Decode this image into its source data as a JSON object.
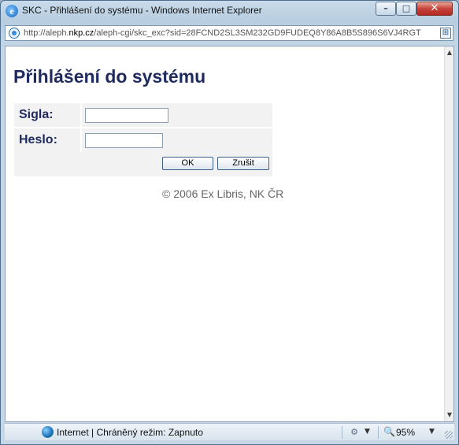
{
  "window": {
    "title": "SKC - Přihlášení do systému - Windows Internet Explorer",
    "minimize_icon": "minimize-icon",
    "maximize_icon": "maximize-icon",
    "close_icon": "close-icon"
  },
  "address": {
    "prefix": "http://aleph.",
    "domain": "nkp.cz",
    "rest": "/aleph-cgi/skc_exc?sid=28FCND2SL3SM232GD9FUDEQ8Y86A8B5S896S6VJ4RGT"
  },
  "page": {
    "heading": "Přihlášení do systému",
    "form": {
      "sigla_label": "Sigla:",
      "sigla_value": "",
      "heslo_label": "Heslo:",
      "heslo_value": "",
      "ok_label": "OK",
      "cancel_label": "Zrušit"
    },
    "footer": "© 2006 Ex Libris, NK ČR"
  },
  "status": {
    "zone_text": "Internet | Chráněný režim: Zapnuto",
    "zoom": "95%"
  },
  "colors": {
    "heading": "#1f2a5e",
    "form_bg": "#f2f2f2",
    "footer_text": "#666666"
  }
}
